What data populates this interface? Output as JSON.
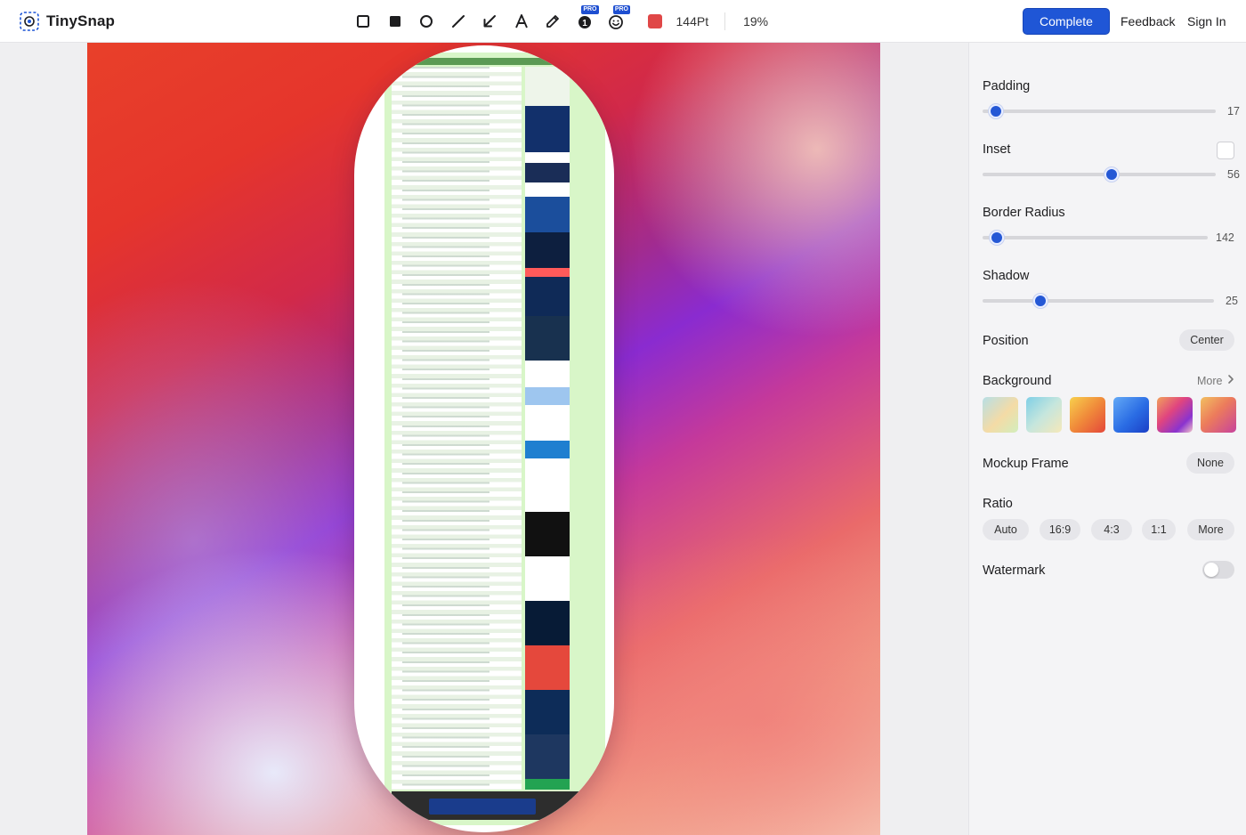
{
  "app": {
    "name": "TinySnap",
    "icon": "app-logo-icon"
  },
  "toolbar": {
    "tools": [
      {
        "id": "rectangle-outline",
        "icon": "square-outline-icon"
      },
      {
        "id": "rectangle-filled",
        "icon": "square-filled-icon"
      },
      {
        "id": "circle",
        "icon": "circle-icon"
      },
      {
        "id": "line",
        "icon": "line-icon"
      },
      {
        "id": "arrow",
        "icon": "arrow-icon"
      },
      {
        "id": "text",
        "icon": "text-icon"
      },
      {
        "id": "pen",
        "icon": "pen-icon"
      },
      {
        "id": "step-number",
        "icon": "number-badge-icon",
        "badge": "PRO",
        "glyph": "1"
      },
      {
        "id": "emoji",
        "icon": "emoji-icon",
        "badge": "PRO"
      }
    ],
    "color": "#e04747",
    "size": "144Pt",
    "zoom": "19%"
  },
  "header": {
    "complete_label": "Complete",
    "feedback_label": "Feedback",
    "signin_label": "Sign In"
  },
  "panel": {
    "padding": {
      "label": "Padding",
      "value": "17",
      "fraction": 0.05
    },
    "inset": {
      "label": "Inset",
      "value": "56",
      "fraction": 0.56,
      "checked": false
    },
    "border_radius": {
      "label": "Border Radius",
      "value": "142",
      "fraction": 0.05
    },
    "shadow": {
      "label": "Shadow",
      "value": "25",
      "fraction": 0.25
    },
    "position": {
      "label": "Position",
      "value": "Center"
    },
    "background": {
      "label": "Background",
      "more_label": "More",
      "swatches": [
        {
          "name": "pastel-rainbow",
          "colors": [
            "#f3d3a6",
            "#9fd8d6"
          ]
        },
        {
          "name": "mint-sand",
          "colors": [
            "#8fd3e6",
            "#f1e7bf"
          ]
        },
        {
          "name": "sunset-orange",
          "colors": [
            "#f7c64a",
            "#ec5f35"
          ]
        },
        {
          "name": "ocean-blue",
          "colors": [
            "#4d93f0",
            "#1a47d6"
          ]
        },
        {
          "name": "vivid-purple",
          "colors": [
            "#e04a77",
            "#7a32cf"
          ]
        },
        {
          "name": "peach-violet",
          "colors": [
            "#f1b058",
            "#d0498f"
          ]
        }
      ]
    },
    "mockup_frame": {
      "label": "Mockup Frame",
      "value": "None"
    },
    "ratio": {
      "label": "Ratio",
      "options": [
        "Auto",
        "16:9",
        "4:3",
        "1:1",
        "More"
      ]
    },
    "watermark": {
      "label": "Watermark",
      "enabled": false
    }
  }
}
